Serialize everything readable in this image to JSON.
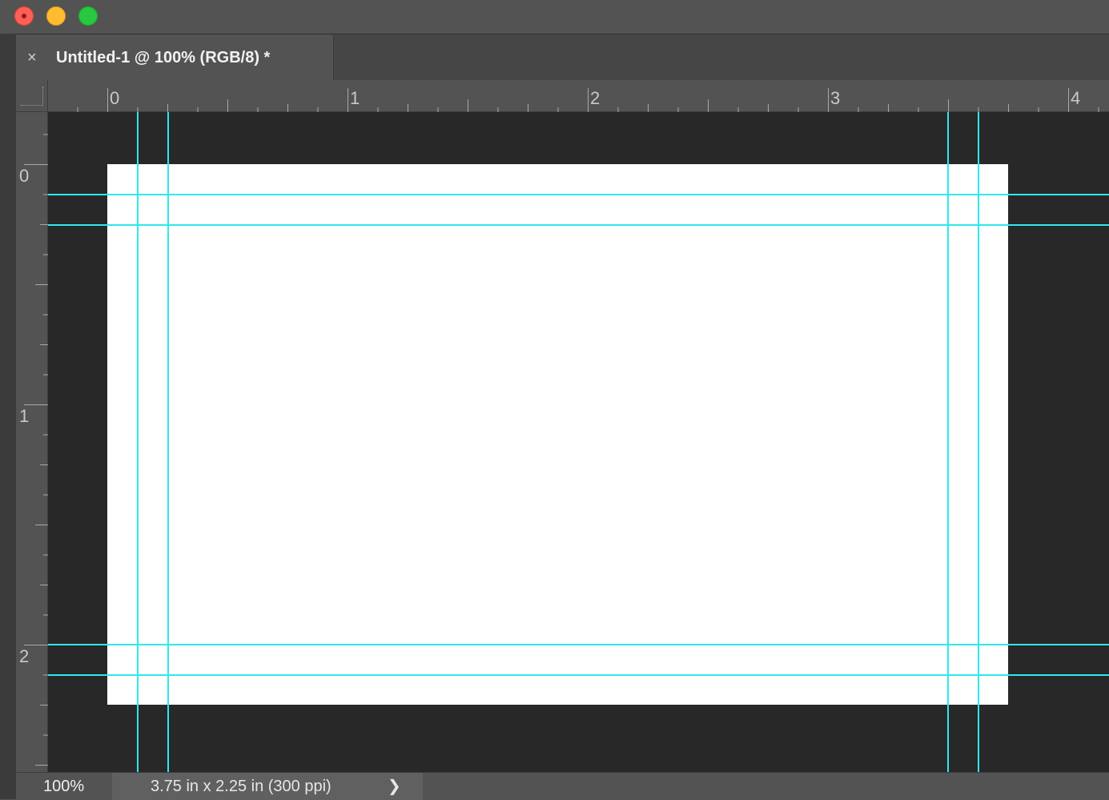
{
  "window": {
    "tab_title": "Untitled-1 @ 100% (RGB/8) *",
    "tab_close_glyph": "×"
  },
  "rulers": {
    "horizontal_labels": [
      "0",
      "1",
      "2",
      "3",
      "4"
    ],
    "vertical_labels": [
      "0",
      "1",
      "2"
    ]
  },
  "status": {
    "zoom": "100%",
    "doc_info": "3.75 in x 2.25 in (300 ppi)",
    "arrow_glyph": "❯"
  },
  "colors": {
    "guide": "#2ee8ee",
    "pasteboard": "#282828",
    "document": "#ffffff"
  }
}
